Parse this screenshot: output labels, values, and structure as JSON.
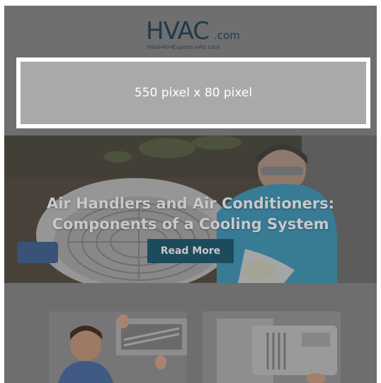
{
  "header": {
    "logo_main": "HVAC",
    "logo_suffix": ".com",
    "logo_tagline": "Heat•Air•Experts who care"
  },
  "ad_banner": {
    "label": "550 pixel x 80 pixel"
  },
  "hero": {
    "title_line1": "Air Handlers and Air Conditioners:",
    "title_line2": "Components of a Cooling System",
    "button_label": "Read More"
  },
  "colors": {
    "overlay_gray": "#6e6e6e",
    "brand_navy": "#1f3a4d",
    "button_teal": "#1d4b5e"
  }
}
